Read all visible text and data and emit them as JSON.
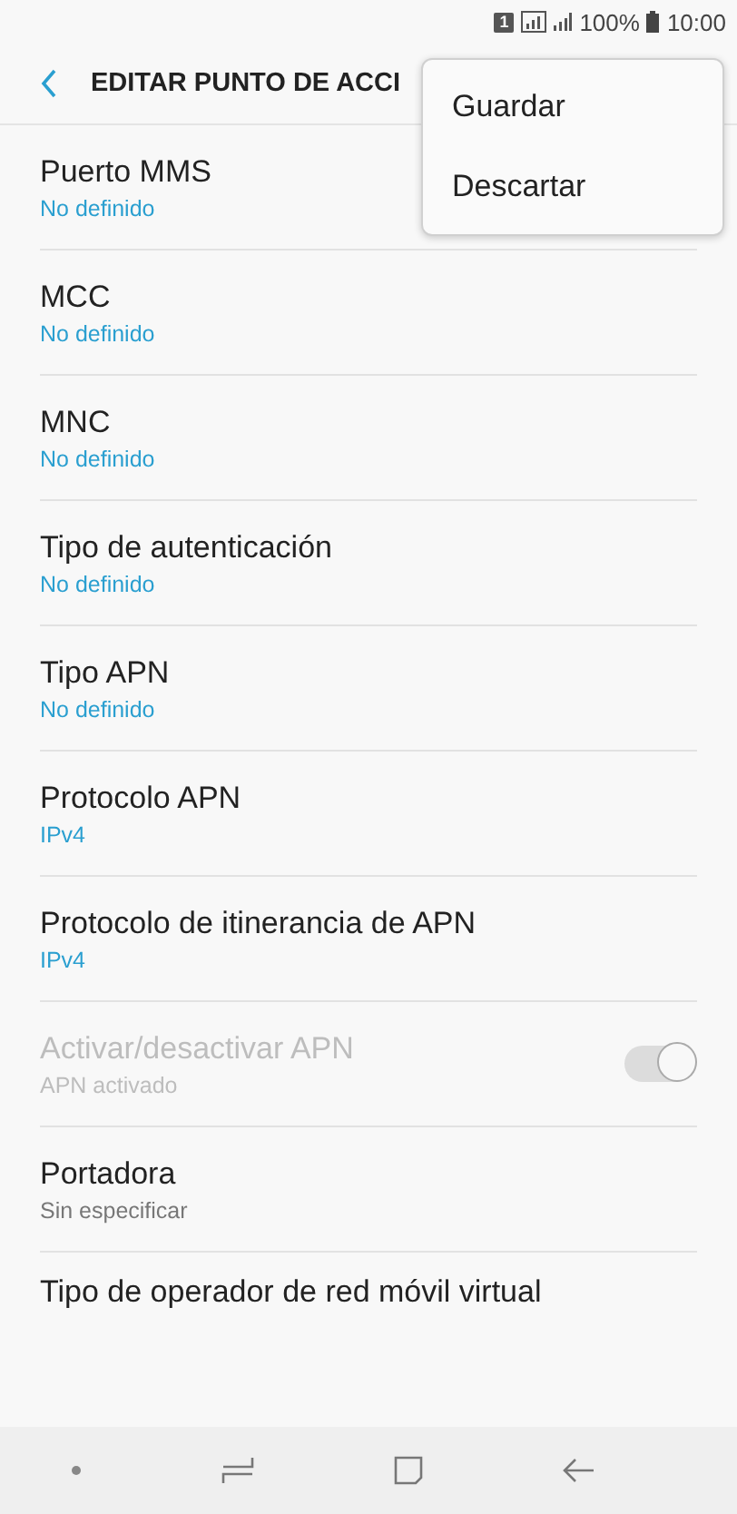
{
  "status_bar": {
    "battery": "100%",
    "time": "10:00",
    "sim": "1"
  },
  "header": {
    "title": "EDITAR PUNTO DE ACCI"
  },
  "menu": {
    "items": [
      "Guardar",
      "Descartar"
    ]
  },
  "settings": [
    {
      "kind": "value",
      "title": "Puerto MMS",
      "value": "No definido",
      "accent": true,
      "disabled": false
    },
    {
      "kind": "value",
      "title": "MCC",
      "value": "No definido",
      "accent": true,
      "disabled": false
    },
    {
      "kind": "value",
      "title": "MNC",
      "value": "No definido",
      "accent": true,
      "disabled": false
    },
    {
      "kind": "value",
      "title": "Tipo de autenticación",
      "value": "No definido",
      "accent": true,
      "disabled": false
    },
    {
      "kind": "value",
      "title": "Tipo APN",
      "value": "No definido",
      "accent": true,
      "disabled": false
    },
    {
      "kind": "value",
      "title": "Protocolo APN",
      "value": "IPv4",
      "accent": true,
      "disabled": false
    },
    {
      "kind": "value",
      "title": "Protocolo de itinerancia de APN",
      "value": "IPv4",
      "accent": true,
      "disabled": false
    },
    {
      "kind": "switch",
      "title": "Activar/desactivar APN",
      "value": "APN activado",
      "on": true,
      "disabled": true
    },
    {
      "kind": "value",
      "title": "Portadora",
      "value": "Sin especificar",
      "accent": false,
      "disabled": false
    },
    {
      "kind": "title",
      "title": "Tipo de operador de red móvil virtual",
      "disabled": false
    }
  ]
}
